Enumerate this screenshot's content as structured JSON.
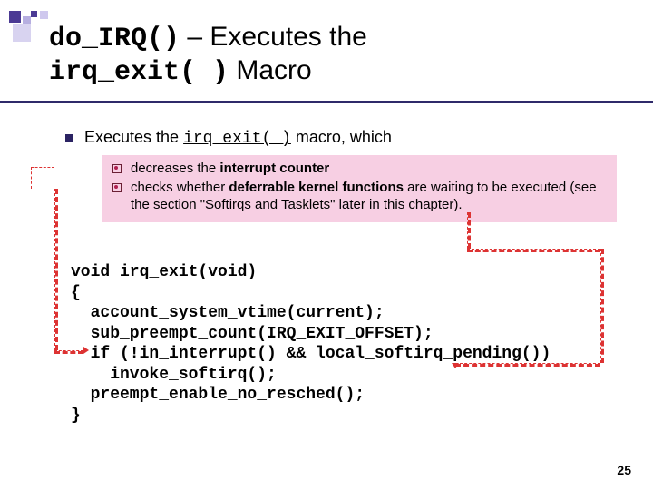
{
  "title": {
    "code1": "do_IRQ()",
    "sep": " – ",
    "plain1": "Executes the",
    "code2": "irq_exit( )",
    "plain2": " Macro"
  },
  "bullet1": {
    "prefix": "Executes the ",
    "code": "irq_exit( )",
    "suffix": " macro, which"
  },
  "sub": {
    "item1_prefix": "decreases the ",
    "item1_bold": "interrupt counter",
    "item2_prefix": "checks whether ",
    "item2_bold": "deferrable kernel functions",
    "item2_suffix": " are waiting to be executed (see the section \"Softirqs and Tasklets\" later in this chapter)."
  },
  "code": {
    "l1": "void irq_exit(void)",
    "l2": "{",
    "l3": "  account_system_vtime(current);",
    "l4": "  sub_preempt_count(IRQ_EXIT_OFFSET);",
    "l5": "  if (!in_interrupt() && local_softirq_pending())",
    "l6": "    invoke_softirq();",
    "l7": "  preempt_enable_no_resched();",
    "l8": "}"
  },
  "page_number": "25"
}
